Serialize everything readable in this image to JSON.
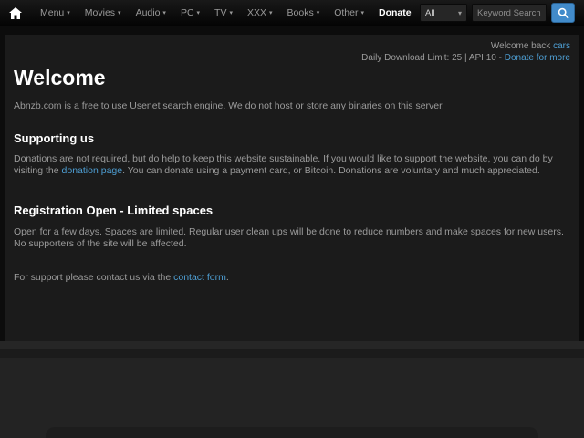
{
  "navbar": {
    "items": [
      {
        "label": "Menu",
        "dropdown": true
      },
      {
        "label": "Movies",
        "dropdown": true
      },
      {
        "label": "Audio",
        "dropdown": true
      },
      {
        "label": "PC",
        "dropdown": true
      },
      {
        "label": "TV",
        "dropdown": true
      },
      {
        "label": "XXX",
        "dropdown": true
      },
      {
        "label": "Books",
        "dropdown": true
      },
      {
        "label": "Other",
        "dropdown": true
      },
      {
        "label": "Donate",
        "dropdown": false
      }
    ],
    "search": {
      "category": "All",
      "placeholder": "Keyword Search"
    }
  },
  "icons": {
    "caret": "▾",
    "select_caret": "▾"
  },
  "userbar": {
    "welcome_prefix": "Welcome back ",
    "username": "cars",
    "limit_text": "Daily Download Limit: 25 | API 10 - ",
    "donate_link": "Donate for more"
  },
  "content": {
    "title": "Welcome",
    "intro": "Abnzb.com is a free to use Usenet search engine. We do not host or store any binaries on this server.",
    "supporting": {
      "heading": "Supporting us",
      "text_before_link": "Donations are not required, but do help to keep this website sustainable. If you would like to support the website, you can do by visiting the ",
      "link": "donation page",
      "text_after_link": ". You can donate using a payment card, or Bitcoin. Donations are voluntary and much appreciated."
    },
    "registration": {
      "heading": "Registration Open - Limited spaces",
      "text": "Open for a few days. Spaces are limited. Regular user clean ups will be done to reduce numbers and make spaces for new users. No supporters of the site will be affected."
    },
    "contact": {
      "text_before_link": "For support please contact us via the ",
      "link": "contact form",
      "text_after_link": "."
    }
  },
  "colors": {
    "accent_blue": "#428bca",
    "link_blue": "#4e9fd4",
    "panel_bg": "#1b1b1b",
    "navbar_bg": "#0a0a0a"
  }
}
